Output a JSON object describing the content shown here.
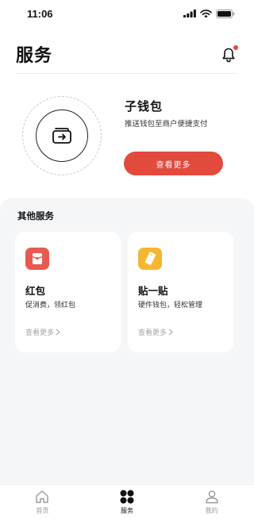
{
  "status_bar": {
    "time": "11:06"
  },
  "header": {
    "title": "服务"
  },
  "wallet": {
    "title": "子钱包",
    "description": "推送钱包至商户便捷支付",
    "button_label": "查看更多"
  },
  "other_services": {
    "title": "其他服务",
    "cards": [
      {
        "title": "红包",
        "description": "促消费，领红包",
        "more": "查看更多",
        "icon": "red-envelope-icon",
        "color": "#e85a4f"
      },
      {
        "title": "贴一贴",
        "description": "硬件钱包，轻松管理",
        "more": "查看更多",
        "icon": "hardware-wallet-icon",
        "color": "#f5b731"
      }
    ]
  },
  "tabbar": {
    "items": [
      {
        "label": "首页",
        "icon": "home-icon",
        "active": false
      },
      {
        "label": "服务",
        "icon": "services-icon",
        "active": true
      },
      {
        "label": "我的",
        "icon": "profile-icon",
        "active": false
      }
    ]
  },
  "colors": {
    "accent": "#e24a3c",
    "badge": "#e84a3d",
    "panel_bg": "#f5f6f8"
  }
}
